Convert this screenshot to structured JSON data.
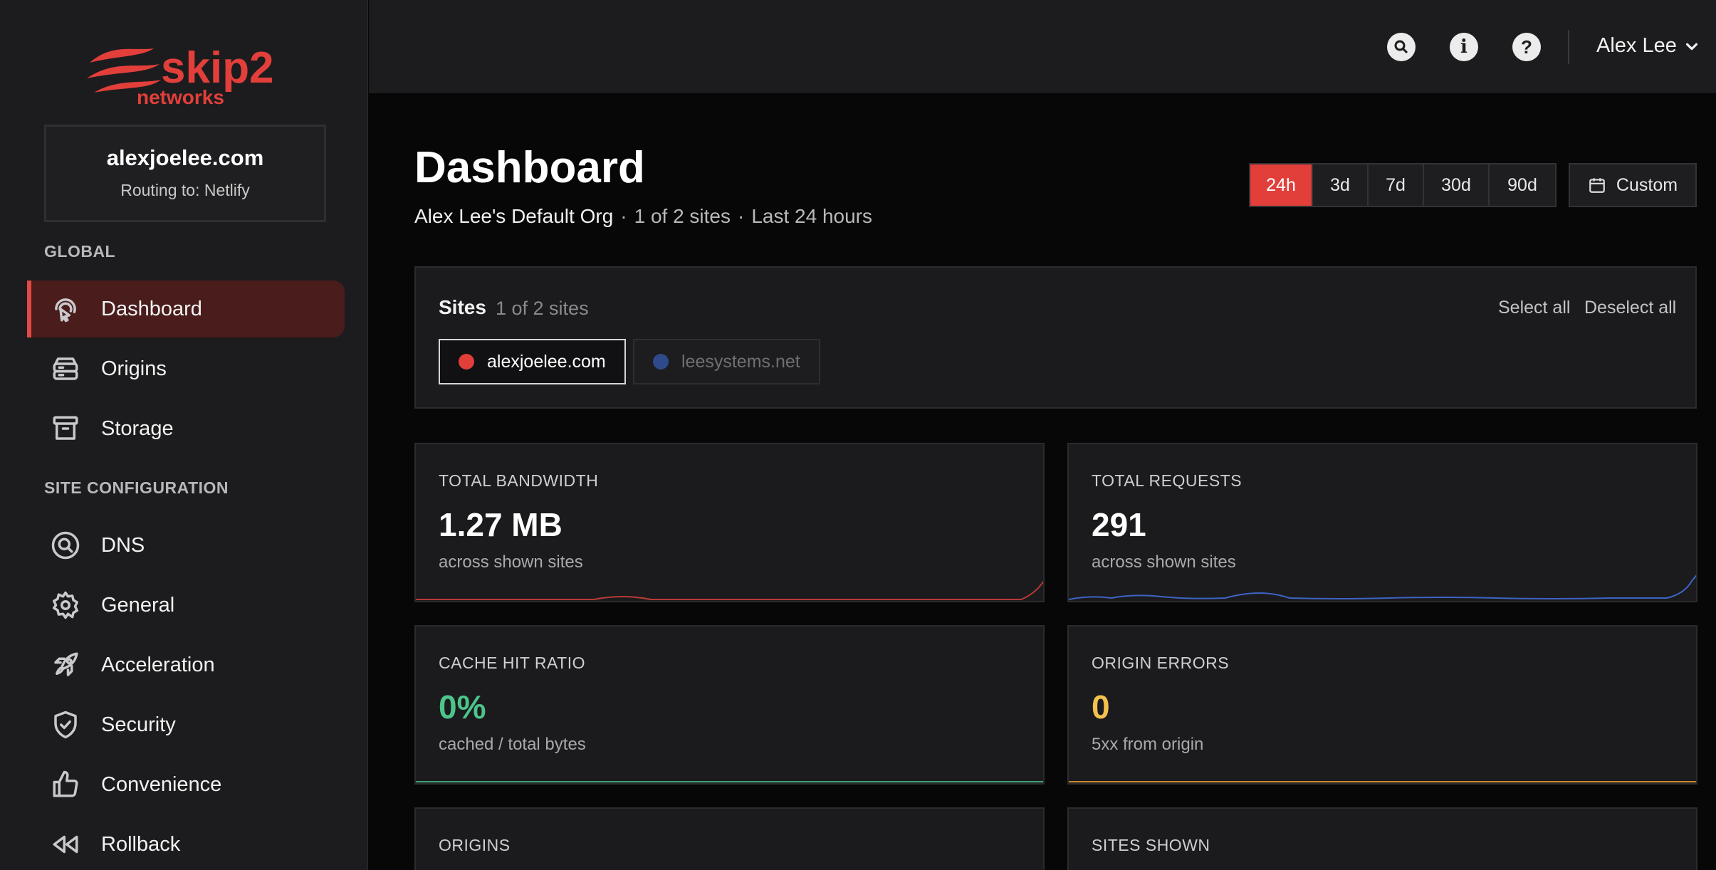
{
  "brand": {
    "name": "skip2",
    "sub": "networks",
    "accent": "#e23f3b"
  },
  "site_box": {
    "domain": "alexjoelee.com",
    "routing": "Routing to: Netlify"
  },
  "sidebar": {
    "global_label": "GLOBAL",
    "global_items": [
      {
        "label": "Dashboard",
        "icon": "pointer-icon",
        "active": true
      },
      {
        "label": "Origins",
        "icon": "server-icon"
      },
      {
        "label": "Storage",
        "icon": "archive-icon"
      }
    ],
    "config_label": "SITE CONFIGURATION",
    "config_items": [
      {
        "label": "DNS",
        "icon": "search-icon"
      },
      {
        "label": "General",
        "icon": "gear-icon"
      },
      {
        "label": "Acceleration",
        "icon": "rocket-icon"
      },
      {
        "label": "Security",
        "icon": "shield-icon"
      },
      {
        "label": "Convenience",
        "icon": "thumbs-up-icon"
      },
      {
        "label": "Rollback",
        "icon": "rewind-icon"
      }
    ]
  },
  "topbar": {
    "user": "Alex Lee"
  },
  "page": {
    "title": "Dashboard",
    "org": "Alex Lee's Default Org",
    "sites_info": "1 of 2 sites",
    "range_info": "Last 24 hours"
  },
  "range": {
    "options": [
      "24h",
      "3d",
      "7d",
      "30d",
      "90d"
    ],
    "selected": "24h",
    "custom": "Custom"
  },
  "sites": {
    "title": "Sites",
    "count": "1 of 2 sites",
    "select_all": "Select all",
    "deselect_all": "Deselect all",
    "chips": [
      {
        "label": "alexjoelee.com",
        "color": "#e23f3b",
        "selected": true
      },
      {
        "label": "leesystems.net",
        "color": "#2f4a8a",
        "selected": false
      }
    ]
  },
  "cards": {
    "bandwidth": {
      "title": "TOTAL BANDWIDTH",
      "value": "1.27 MB",
      "sub": "across shown sites",
      "color": "#b83a36"
    },
    "requests": {
      "title": "TOTAL REQUESTS",
      "value": "291",
      "sub": "across shown sites",
      "color": "#3d63c4"
    },
    "cache": {
      "title": "CACHE HIT RATIO",
      "value": "0%",
      "sub": "cached / total bytes",
      "color": "#4cc48a"
    },
    "errors": {
      "title": "ORIGIN ERRORS",
      "value": "0",
      "sub": "5xx from origin",
      "color": "#f2c14e"
    },
    "origins": {
      "title": "ORIGINS"
    },
    "sites_shown": {
      "title": "SITES SHOWN"
    }
  }
}
